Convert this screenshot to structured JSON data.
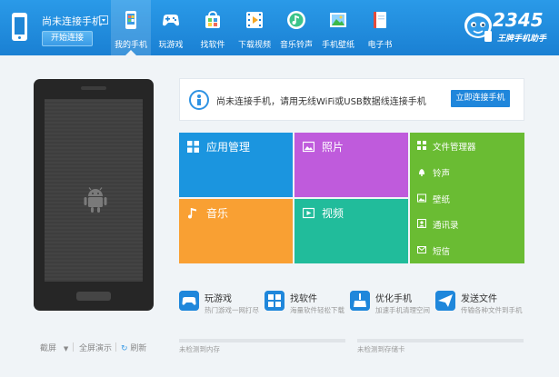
{
  "header": {
    "connection_title": "尚未连接手机",
    "connect_button": "开始连接",
    "nav": [
      {
        "label": "我的手机",
        "icon": "my-phone-icon"
      },
      {
        "label": "玩游戏",
        "icon": "gamepad-icon"
      },
      {
        "label": "找软件",
        "icon": "software-bag-icon"
      },
      {
        "label": "下载视频",
        "icon": "film-icon"
      },
      {
        "label": "音乐铃声",
        "icon": "music-note-icon"
      },
      {
        "label": "手机壁纸",
        "icon": "wallpaper-icon"
      },
      {
        "label": "电子书",
        "icon": "book-icon"
      }
    ],
    "active_nav": "我的手机",
    "logo_number": "2345",
    "logo_subtitle": "王牌手机助手"
  },
  "phone_panel": {
    "screen_icon": "android-robot-icon",
    "actions": [
      {
        "label": "截屏",
        "icon": "chevron-down-icon"
      },
      {
        "label": "全屏演示"
      },
      {
        "label": "刷新",
        "icon": "refresh-icon"
      }
    ]
  },
  "banner": {
    "message": "尚未连接手机，请用无线WiFi或USB数据线连接手机",
    "button": "立即连接手机"
  },
  "tiles": {
    "app_manager": "应用管理",
    "photos": "照片",
    "music": "音乐",
    "video": "视频",
    "list": [
      {
        "label": "文件管理器",
        "icon": "folder-icon"
      },
      {
        "label": "铃声",
        "icon": "bell-icon"
      },
      {
        "label": "壁纸",
        "icon": "picture-icon"
      },
      {
        "label": "通讯录",
        "icon": "contacts-icon"
      },
      {
        "label": "短信",
        "icon": "sms-icon"
      }
    ]
  },
  "features": [
    {
      "title": "玩游戏",
      "subtitle": "热门游戏一网打尽",
      "icon": "gamepad-icon"
    },
    {
      "title": "找软件",
      "subtitle": "海量软件轻松下载",
      "icon": "apps-grid-icon"
    },
    {
      "title": "优化手机",
      "subtitle": "加速手机清理空间",
      "icon": "broom-icon"
    },
    {
      "title": "发送文件",
      "subtitle": "传输各种文件到手机",
      "icon": "send-icon"
    }
  ],
  "storage": {
    "memory_text": "未检测到内存",
    "card_text": "未检测到存储卡",
    "memory_fraction": 0,
    "card_fraction": 0
  },
  "colors": {
    "header_blue": "#1f86d6",
    "tile_blue": "#1b95df",
    "tile_purple": "#bf5bdc",
    "tile_orange": "#f9a033",
    "tile_teal": "#21bc9b",
    "tile_green": "#6abc33"
  }
}
